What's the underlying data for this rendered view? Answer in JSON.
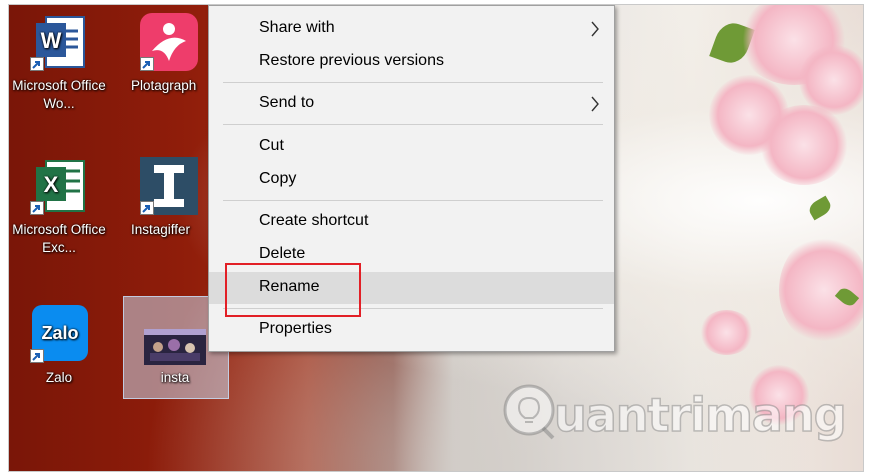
{
  "desktop": {
    "icons": [
      {
        "label": "Microsoft Office Wo...",
        "icon": "word-icon"
      },
      {
        "label": "Plotagraph",
        "icon": "plotagraph-icon"
      },
      {
        "label": "Microsoft Office Exc...",
        "icon": "excel-icon"
      },
      {
        "label": "Instagiffer",
        "icon": "instagiffer-icon"
      },
      {
        "label": "Zalo",
        "icon": "zalo-icon"
      },
      {
        "label": "insta",
        "icon": "video-thumbnail"
      }
    ]
  },
  "context_menu": {
    "items": [
      {
        "label": "Share with",
        "submenu": true
      },
      {
        "label": "Restore previous versions",
        "submenu": false
      },
      {
        "label": "Send to",
        "submenu": true
      },
      {
        "label": "Cut",
        "submenu": false
      },
      {
        "label": "Copy",
        "submenu": false
      },
      {
        "label": "Create shortcut",
        "submenu": false
      },
      {
        "label": "Delete",
        "submenu": false
      },
      {
        "label": "Rename",
        "submenu": false,
        "highlighted": true
      },
      {
        "label": "Properties",
        "submenu": false
      }
    ]
  },
  "watermark": {
    "text": "uantrimang",
    "logo": "lightbulb-q-logo"
  },
  "colors": {
    "highlight_box": "#e21f26",
    "menu_bg": "#f2f2f2",
    "hover_bg": "#dcdcdc"
  }
}
